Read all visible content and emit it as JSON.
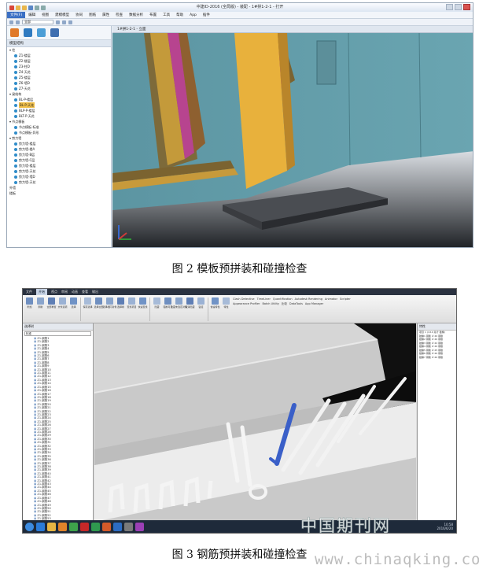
{
  "figure2": {
    "window_title": "中建ID-2016 (全局版) - 装配 - 1#拼1-2-1 - 打开",
    "menu": [
      "文件(F)",
      "编辑",
      "视图",
      "建模模型",
      "协同",
      "图纸",
      "属性",
      "检查",
      "数据分析",
      "布置",
      "工具",
      "帮助",
      "App",
      "插件"
    ],
    "tool_dropdown": "全部",
    "panel_title": "模型结构",
    "view_tab": "1#拼1-2-1 - 立面",
    "tree": [
      {
        "label": "▾ 柱",
        "level": 0
      },
      {
        "label": "Z1-楼层",
        "level": 1
      },
      {
        "label": "Z2-楼层",
        "level": 1
      },
      {
        "label": "Z3-柱D",
        "level": 1
      },
      {
        "label": "Z4-天花",
        "level": 1
      },
      {
        "label": "Z5-楼层",
        "level": 1
      },
      {
        "label": "Z6-墙D",
        "level": 1
      },
      {
        "label": "Z7-天花",
        "level": 1
      },
      {
        "label": "▾ 梁结构",
        "level": 0
      },
      {
        "label": "BL-P-楼层",
        "level": 1
      },
      {
        "label": "BL-P-天花",
        "level": 1,
        "selected": true
      },
      {
        "label": "BLP-P-楼层",
        "level": 1
      },
      {
        "label": "BLT-P-天花",
        "level": 1
      },
      {
        "label": "▾ 节点模板",
        "level": 0
      },
      {
        "label": "节点模板-标准",
        "level": 1
      },
      {
        "label": "节点模板-异形",
        "level": 1
      },
      {
        "label": "▾ 剪力墙",
        "level": 0
      },
      {
        "label": "剪力墙-楼层",
        "level": 1
      },
      {
        "label": "剪力墙-楼A",
        "level": 1
      },
      {
        "label": "剪力墙-B层",
        "level": 1
      },
      {
        "label": "剪力墙-C层",
        "level": 1
      },
      {
        "label": "剪力墙-楼层",
        "level": 1
      },
      {
        "label": "剪力墙-天花",
        "level": 1
      },
      {
        "label": "剪力墙-墙D",
        "level": 1
      },
      {
        "label": "剪力墙-天花",
        "level": 1
      },
      {
        "label": "外墙",
        "level": 0
      },
      {
        "label": "楼板",
        "level": 0
      }
    ],
    "caption": "图 2  模板预拼装和碰撞检查"
  },
  "figure3": {
    "tabs": [
      "文件",
      "开始",
      "视点",
      "审阅",
      "动画",
      "查看",
      "输出"
    ],
    "active_tab": "开始",
    "ribbon_buttons": [
      "附加",
      "刷新",
      "全部重置",
      "文件选项",
      "选择",
      "保存选择",
      "选择全部",
      "选择相同对象",
      "选择树",
      "查找项目",
      "快速查找",
      "隐藏",
      "强制可见",
      "隐藏未选定对象",
      "取消隐藏",
      "链接",
      "快速特性",
      "特性"
    ],
    "ribbon_tools": [
      "Clash Detective",
      "TimeLiner",
      "Quantification",
      "Autodesk Rendering",
      "Animator",
      "Scripter",
      "Appearance Profiler",
      "Batch Utility",
      "比较",
      "DataTools",
      "App Manager"
    ],
    "left_panel_title": "选择树",
    "left_filter": "标准",
    "left_items": [
      "Z1-钢筋1",
      "Z1-钢筋2",
      "Z1-钢筋3",
      "Z1-钢筋4",
      "Z1-钢筋5",
      "Z1-钢筋6",
      "Z1-钢筋7",
      "Z1-钢筋8",
      "Z1-钢筋9",
      "Z1-钢筋10",
      "Z1-钢筋11",
      "Z1-钢筋12",
      "Z1-钢筋13",
      "Z1-钢筋14",
      "Z1-钢筋15",
      "Z1-钢筋16",
      "Z1-钢筋17",
      "Z1-钢筋18",
      "Z1-钢筋19",
      "Z1-钢筋20",
      "Z1-钢筋21",
      "Z1-钢筋22",
      "Z1-钢筋23",
      "Z1-钢筋24",
      "Z1-钢筋25",
      "Z1-钢筋26",
      "Z1-钢筋27",
      "Z1-钢筋28",
      "Z1-钢筋29",
      "Z1-钢筋30",
      "Z1-钢筋31",
      "Z1-钢筋32",
      "Z1-钢筋33",
      "Z1-钢筋34",
      "Z1-钢筋35",
      "Z1-钢筋36",
      "Z1-钢筋37",
      "Z1-钢筋38",
      "Z1-钢筋39",
      "Z1-钢筋40",
      "Z1-钢筋41",
      "Z1-钢筋42",
      "Z1-钢筋43",
      "Z1-钢筋44",
      "Z1-钢筋45",
      "Z1-钢筋46",
      "Z1-钢筋47",
      "Z1-钢筋48",
      "Z1-钢筋49",
      "Z1-钢筋50",
      "Z1-钢筋51",
      "Z1-钢筋52",
      "Z1-钢筋53",
      "Z1-钢筋54",
      "Z1-钢筋55"
    ],
    "right_panel_title": "特性",
    "right_lines": [
      "项目 1 (1/10 总计 碰撞)",
      "碰撞1 钢筋 ∅ 20 钢筋",
      "碰撞2 钢筋 ∅ 20 钢筋",
      "碰撞3 钢筋 ∅ 22 钢筋",
      "碰撞4 钢筋 ∅ 20 钢筋",
      "碰撞5 钢筋 ∅ 25 钢筋",
      "碰撞6 钢筋 ∅ 20 钢筋",
      "碰撞7 钢筋 ∅ 20 钢筋"
    ],
    "clock_time": "10:58",
    "clock_date": "2016/6/20",
    "caption": "图 3  钢筋预拼装和碰撞检查"
  },
  "watermark": {
    "cn": "中国期刊网",
    "url": "www.chinaqking.com"
  },
  "colors": {
    "wall_teal": "#5f9aa6",
    "formwork_orange": "#e3a02e",
    "formwork_magenta": "#b8428f",
    "rebar_highlight": "#3a5fc8",
    "ribbon_blue": "#3a6fc4"
  }
}
